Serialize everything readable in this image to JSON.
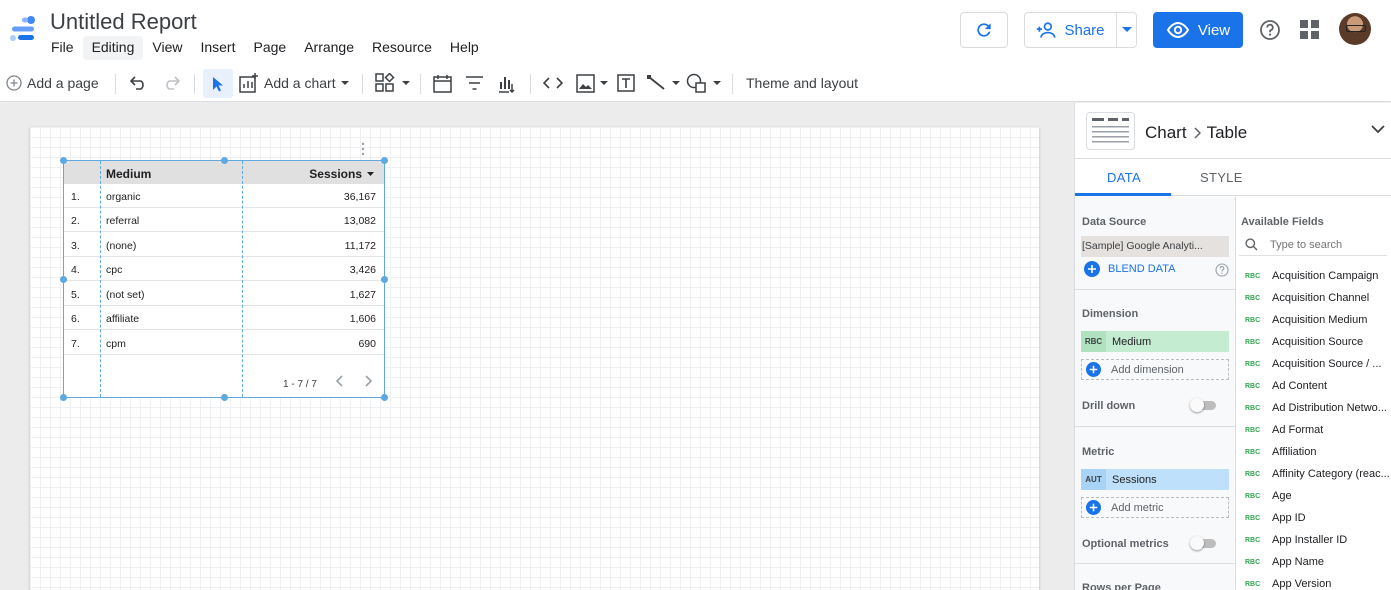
{
  "app": {
    "title": "Untitled Report",
    "menu": [
      "File",
      "Editing",
      "View",
      "Insert",
      "Page",
      "Arrange",
      "Resource",
      "Help"
    ],
    "active_menu": "Editing",
    "share_label": "Share",
    "view_label": "View",
    "accent_color": "#1a73e8"
  },
  "toolbar": {
    "add_page_label": "Add a page",
    "add_chart_label": "Add a chart",
    "theme_label": "Theme and layout"
  },
  "table": {
    "headers": {
      "medium": "Medium",
      "sessions": "Sessions"
    },
    "rows": [
      {
        "num": "1.",
        "medium": "organic",
        "sessions": "36,167"
      },
      {
        "num": "2.",
        "medium": "referral",
        "sessions": "13,082"
      },
      {
        "num": "3.",
        "medium": "(none)",
        "sessions": "11,172"
      },
      {
        "num": "4.",
        "medium": "cpc",
        "sessions": "3,426"
      },
      {
        "num": "5.",
        "medium": "(not set)",
        "sessions": "1,627"
      },
      {
        "num": "6.",
        "medium": "affiliate",
        "sessions": "1,606"
      },
      {
        "num": "7.",
        "medium": "cpm",
        "sessions": "690"
      }
    ],
    "pagination": "1 - 7 / 7"
  },
  "panel": {
    "crumb_parent": "Chart",
    "crumb_child": "Table",
    "tab_data": "DATA",
    "tab_style": "STYLE",
    "data_source_label": "Data Source",
    "data_source_value": "[Sample] Google Analyti...",
    "blend_label": "BLEND DATA",
    "dimension_label": "Dimension",
    "dimension_tag": "RBC",
    "dimension_value": "Medium",
    "add_dimension": "Add dimension",
    "drill_down_label": "Drill down",
    "metric_label": "Metric",
    "metric_tag": "AUT",
    "metric_value": "Sessions",
    "add_metric": "Add metric",
    "optional_metrics_label": "Optional metrics",
    "rows_per_page_label": "Rows per Page",
    "available_fields_label": "Available Fields",
    "search_placeholder": "Type to search",
    "field_tag": "RBC",
    "fields": [
      "Acquisition Campaign",
      "Acquisition Channel",
      "Acquisition Medium",
      "Acquisition Source",
      "Acquisition Source / ...",
      "Ad Content",
      "Ad Distribution Netwo...",
      "Ad Format",
      "Affiliation",
      "Affinity Category (reac...",
      "Age",
      "App ID",
      "App Installer ID",
      "App Name",
      "App Version"
    ]
  }
}
